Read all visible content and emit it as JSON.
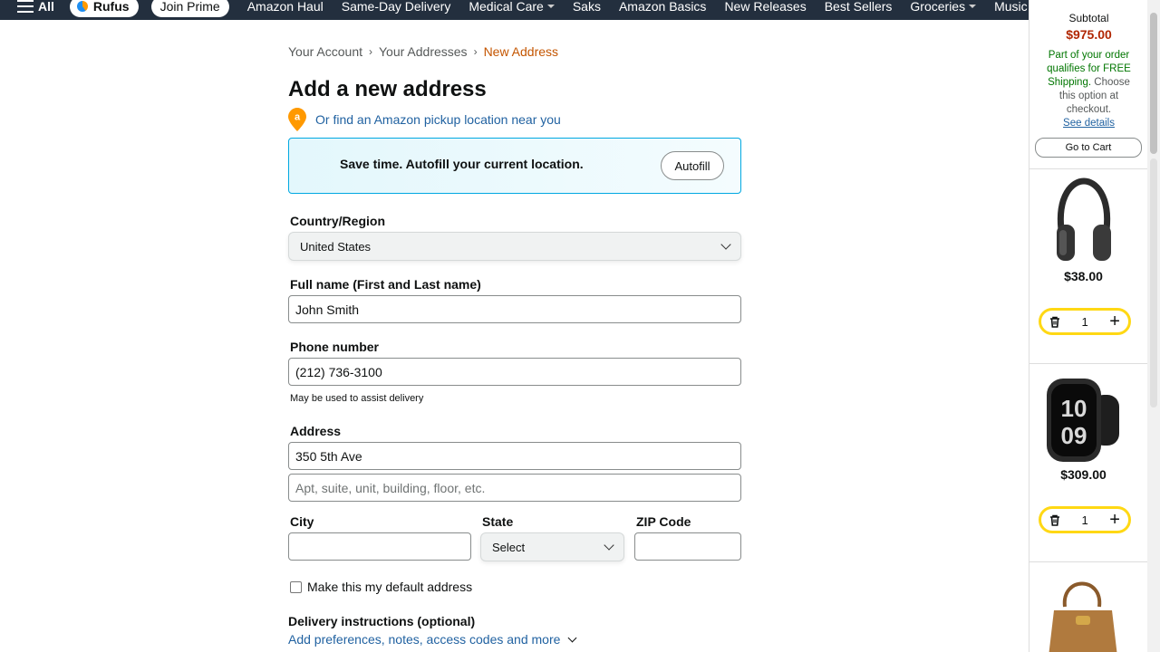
{
  "nav": {
    "all_label": "All",
    "rufus_label": "Rufus",
    "prime_label": "Join Prime",
    "links": [
      "Amazon Haul",
      "Same-Day Delivery",
      "Medical Care",
      "Saks",
      "Amazon Basics",
      "New Releases",
      "Best Sellers",
      "Groceries",
      "Music"
    ]
  },
  "breadcrumb": {
    "account": "Your Account",
    "addresses": "Your Addresses",
    "current": "New Address",
    "separator": "›"
  },
  "page_title": "Add a new address",
  "pickup_link": "Or find an Amazon pickup location near you",
  "autofill": {
    "text": "Save time. Autofill your current location.",
    "button": "Autofill"
  },
  "form": {
    "country_label": "Country/Region",
    "country_value": "United States",
    "fullname_label": "Full name (First and Last name)",
    "fullname_value": "John Smith",
    "phone_label": "Phone number",
    "phone_value": "(212) 736-3100",
    "phone_hint": "May be used to assist delivery",
    "address_label": "Address",
    "address_line1": "350 5th Ave",
    "address_line2_placeholder": "Apt, suite, unit, building, floor, etc.",
    "city_label": "City",
    "city_value": "",
    "state_label": "State",
    "state_value": "Select",
    "zip_label": "ZIP Code",
    "zip_value": "",
    "default_checkbox": "Make this my default address",
    "delivery_title": "Delivery instructions (optional)",
    "delivery_link": "Add preferences, notes, access codes and more"
  },
  "cart": {
    "subtotal_label": "Subtotal",
    "subtotal_value": "$975.00",
    "ship_green": "Part of your order qualifies for FREE Shipping.",
    "ship_rest": "Choose this option at checkout.",
    "see_details": "See details",
    "go_to_cart": "Go to Cart",
    "items": [
      {
        "price": "$38.00",
        "qty": "1",
        "icon": "headphones-icon"
      },
      {
        "price": "$309.00",
        "qty": "1",
        "icon": "smartwatch-icon"
      },
      {
        "icon": "handbag-icon"
      }
    ]
  },
  "colors": {
    "nav_bg": "#232f3e",
    "link": "#2162a1",
    "breadcrumb_current": "#c45500",
    "price_red": "#b12704",
    "free_shipping_green": "#007600",
    "qty_border": "#ffd814",
    "autofill_border": "#00a8e1"
  }
}
